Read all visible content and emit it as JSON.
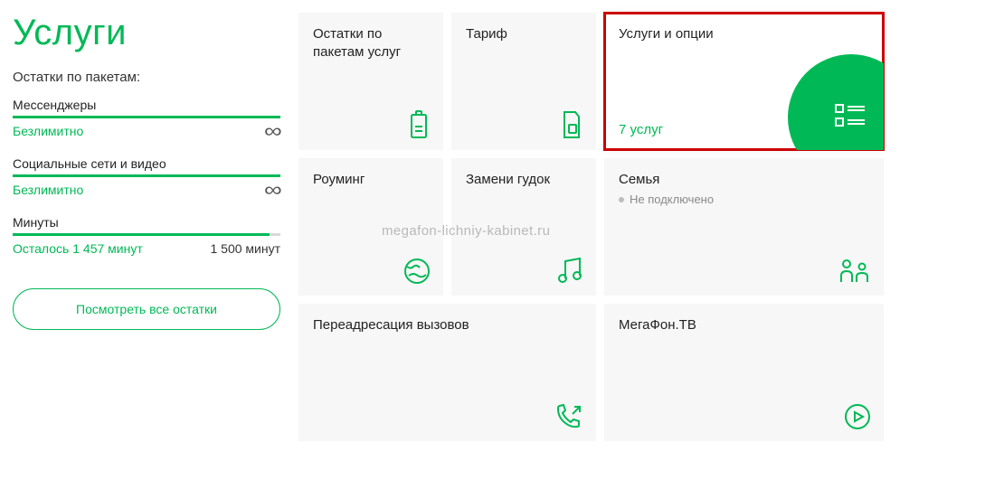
{
  "sidebar": {
    "title": "Услуги",
    "subtitle": "Остатки по пакетам:",
    "blocks": [
      {
        "label": "Мессенджеры",
        "left": "Безлимитно",
        "right_infinity": true
      },
      {
        "label": "Социальные сети и видео",
        "left": "Безлимитно",
        "right_infinity": true
      },
      {
        "label": "Минуты",
        "left": "Осталось 1 457 минут",
        "right": "1 500 минут",
        "partial": true
      }
    ],
    "button": "Посмотреть все остатки"
  },
  "cards": {
    "remains": {
      "title": "Остатки по пакетам услуг"
    },
    "tariff": {
      "title": "Тариф"
    },
    "services": {
      "title": "Услуги и опции",
      "footer": "7 услуг"
    },
    "roaming": {
      "title": "Роуминг"
    },
    "ringtone": {
      "title": "Замени гудок"
    },
    "family": {
      "title": "Семья",
      "sub": "Не подключено"
    },
    "forwarding": {
      "title": "Переадресация вызовов"
    },
    "tv": {
      "title": "МегаФон.ТВ"
    }
  },
  "watermark": "megafon-lichniy-kabinet.ru"
}
